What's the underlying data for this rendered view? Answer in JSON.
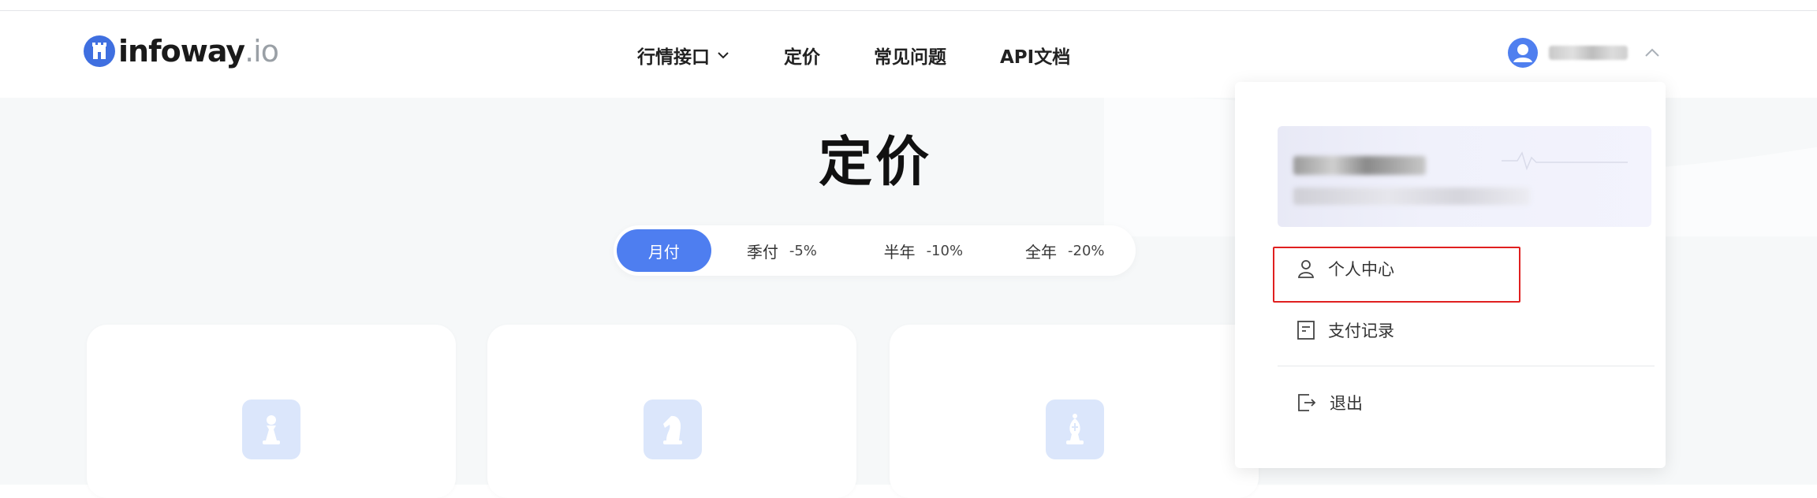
{
  "brand": {
    "name_bold": "infoway",
    "name_suffix": ".io"
  },
  "nav": {
    "items": [
      {
        "label": "行情接口",
        "has_dropdown": true
      },
      {
        "label": "定价"
      },
      {
        "label": "常见问题"
      },
      {
        "label": "API文档"
      }
    ]
  },
  "user": {
    "avatar_icon": "user-avatar-icon",
    "menu_state": "open"
  },
  "page": {
    "title": "定价"
  },
  "billing_tabs": [
    {
      "label": "月付",
      "discount": "",
      "active": true
    },
    {
      "label": "季付",
      "discount": "-5%",
      "active": false
    },
    {
      "label": "半年",
      "discount": "-10%",
      "active": false
    },
    {
      "label": "全年",
      "discount": "-20%",
      "active": false
    }
  ],
  "plans": [
    {
      "icon": "pawn-icon"
    },
    {
      "icon": "knight-icon"
    },
    {
      "icon": "bishop-icon"
    }
  ],
  "user_menu": {
    "items": [
      {
        "label": "个人中心",
        "icon": "user-icon",
        "highlighted": true
      },
      {
        "label": "支付记录",
        "icon": "receipt-icon"
      },
      {
        "label": "退出",
        "icon": "logout-icon"
      }
    ]
  },
  "colors": {
    "accent": "#4e7ef0",
    "highlight": "#e02020",
    "logo": "#3f6fe0",
    "icon_bg": "#dbe6fb"
  }
}
